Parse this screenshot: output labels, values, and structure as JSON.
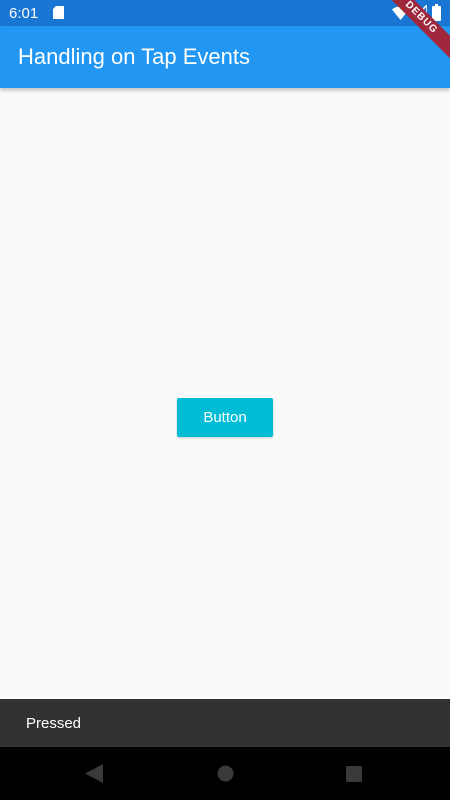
{
  "status_bar": {
    "time": "6:01",
    "icons": [
      "sd-card-icon",
      "wifi-icon",
      "signal-icon",
      "battery-icon"
    ]
  },
  "app_bar": {
    "title": "Handling on Tap Events",
    "color": "#2196F3"
  },
  "debug_banner": {
    "label": "DEBUG",
    "color": "#A0283D"
  },
  "main": {
    "button_label": "Button",
    "button_color": "#00BCD4",
    "background": "#FAFAFA"
  },
  "snackbar": {
    "message": "Pressed",
    "color": "#323232"
  },
  "nav_bar": {
    "icons": [
      "back-icon",
      "home-icon",
      "recents-icon"
    ]
  }
}
